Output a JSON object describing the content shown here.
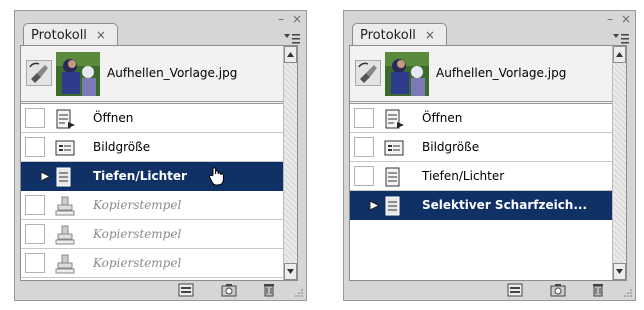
{
  "panels": [
    {
      "tab_label": "Protokoll",
      "tab_close": "×",
      "window_controls": {
        "minimize": "–",
        "close": "×"
      },
      "snapshot_name": "Aufhellen_Vorlage.jpg",
      "history": [
        {
          "label": "Öffnen",
          "icon": "open-document-icon",
          "state": "normal"
        },
        {
          "label": "Bildgröße",
          "icon": "image-size-icon",
          "state": "normal"
        },
        {
          "label": "Tiefen/Lichter",
          "icon": "adjustment-icon",
          "state": "selected"
        },
        {
          "label": "Kopierstempel",
          "icon": "clone-stamp-icon",
          "state": "dimmed"
        },
        {
          "label": "Kopierstempel",
          "icon": "clone-stamp-icon",
          "state": "dimmed"
        },
        {
          "label": "Kopierstempel",
          "icon": "clone-stamp-icon",
          "state": "dimmed"
        }
      ]
    },
    {
      "tab_label": "Protokoll",
      "tab_close": "×",
      "window_controls": {
        "minimize": "–",
        "close": "×"
      },
      "snapshot_name": "Aufhellen_Vorlage.jpg",
      "history": [
        {
          "label": "Öffnen",
          "icon": "open-document-icon",
          "state": "normal"
        },
        {
          "label": "Bildgröße",
          "icon": "image-size-icon",
          "state": "normal"
        },
        {
          "label": "Tiefen/Lichter",
          "icon": "adjustment-icon",
          "state": "normal"
        },
        {
          "label": "Selektiver Scharfzeich...",
          "icon": "adjustment-icon",
          "state": "selected"
        }
      ]
    }
  ],
  "toolbar_icons": [
    "new-document-from-state-icon",
    "new-snapshot-icon",
    "trash-icon"
  ],
  "colors": {
    "selection": "#0f3166",
    "panel": "#d6d6d6"
  }
}
